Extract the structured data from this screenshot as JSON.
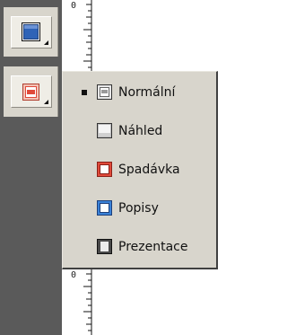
{
  "toolbox": {
    "tools": [
      {
        "icon": "standard-screen-mode-icon",
        "color": "#2f63b7"
      },
      {
        "icon": "view-mode-icon",
        "color": "#e04a3a"
      }
    ]
  },
  "ruler": {
    "labels": [
      "0",
      "0"
    ]
  },
  "view_menu": {
    "selected": "Normální",
    "items": [
      {
        "label": "Normální",
        "icon": "normal-view-icon",
        "checked": true
      },
      {
        "label": "Náhled",
        "icon": "preview-view-icon",
        "checked": false
      },
      {
        "label": "Spadávka",
        "icon": "bleed-view-icon",
        "checked": false
      },
      {
        "label": "Popisy",
        "icon": "slug-view-icon",
        "checked": false
      },
      {
        "label": "Prezentace",
        "icon": "presentation-icon",
        "checked": false
      }
    ]
  },
  "colors": {
    "menu_bg": "#d8d5cc",
    "toolbox_bg": "#5a5a5a",
    "accent_blue": "#2f63b7",
    "accent_red": "#e04a3a"
  }
}
